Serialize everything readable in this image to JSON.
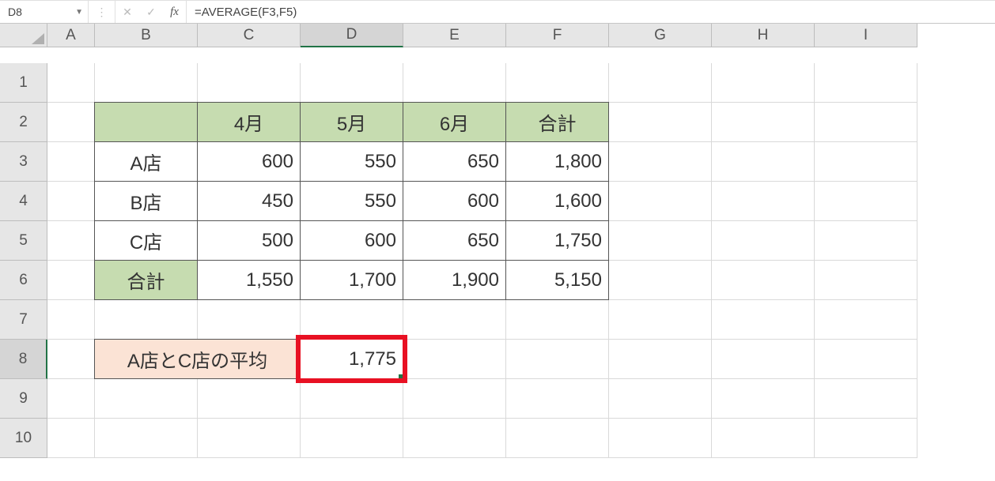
{
  "formula_bar": {
    "name_box": "D8",
    "formula": "=AVERAGE(F3,F5)",
    "fx_label": "fx"
  },
  "columns": [
    "A",
    "B",
    "C",
    "D",
    "E",
    "F",
    "G",
    "H",
    "I"
  ],
  "rows": [
    "1",
    "2",
    "3",
    "4",
    "5",
    "6",
    "7",
    "8",
    "9",
    "10"
  ],
  "table": {
    "header": {
      "c": "4月",
      "d": "5月",
      "e": "6月",
      "f": "合計"
    },
    "rows": {
      "r3": {
        "b": "A店",
        "c": "600",
        "d": "550",
        "e": "650",
        "f": "1,800"
      },
      "r4": {
        "b": "B店",
        "c": "450",
        "d": "550",
        "e": "600",
        "f": "1,600"
      },
      "r5": {
        "b": "C店",
        "c": "500",
        "d": "600",
        "e": "650",
        "f": "1,750"
      },
      "r6": {
        "b": "合計",
        "c": "1,550",
        "d": "1,700",
        "e": "1,900",
        "f": "5,150"
      }
    }
  },
  "avg_row": {
    "label": "A店とC店の平均",
    "value": "1,775"
  },
  "active_cell": "D8"
}
